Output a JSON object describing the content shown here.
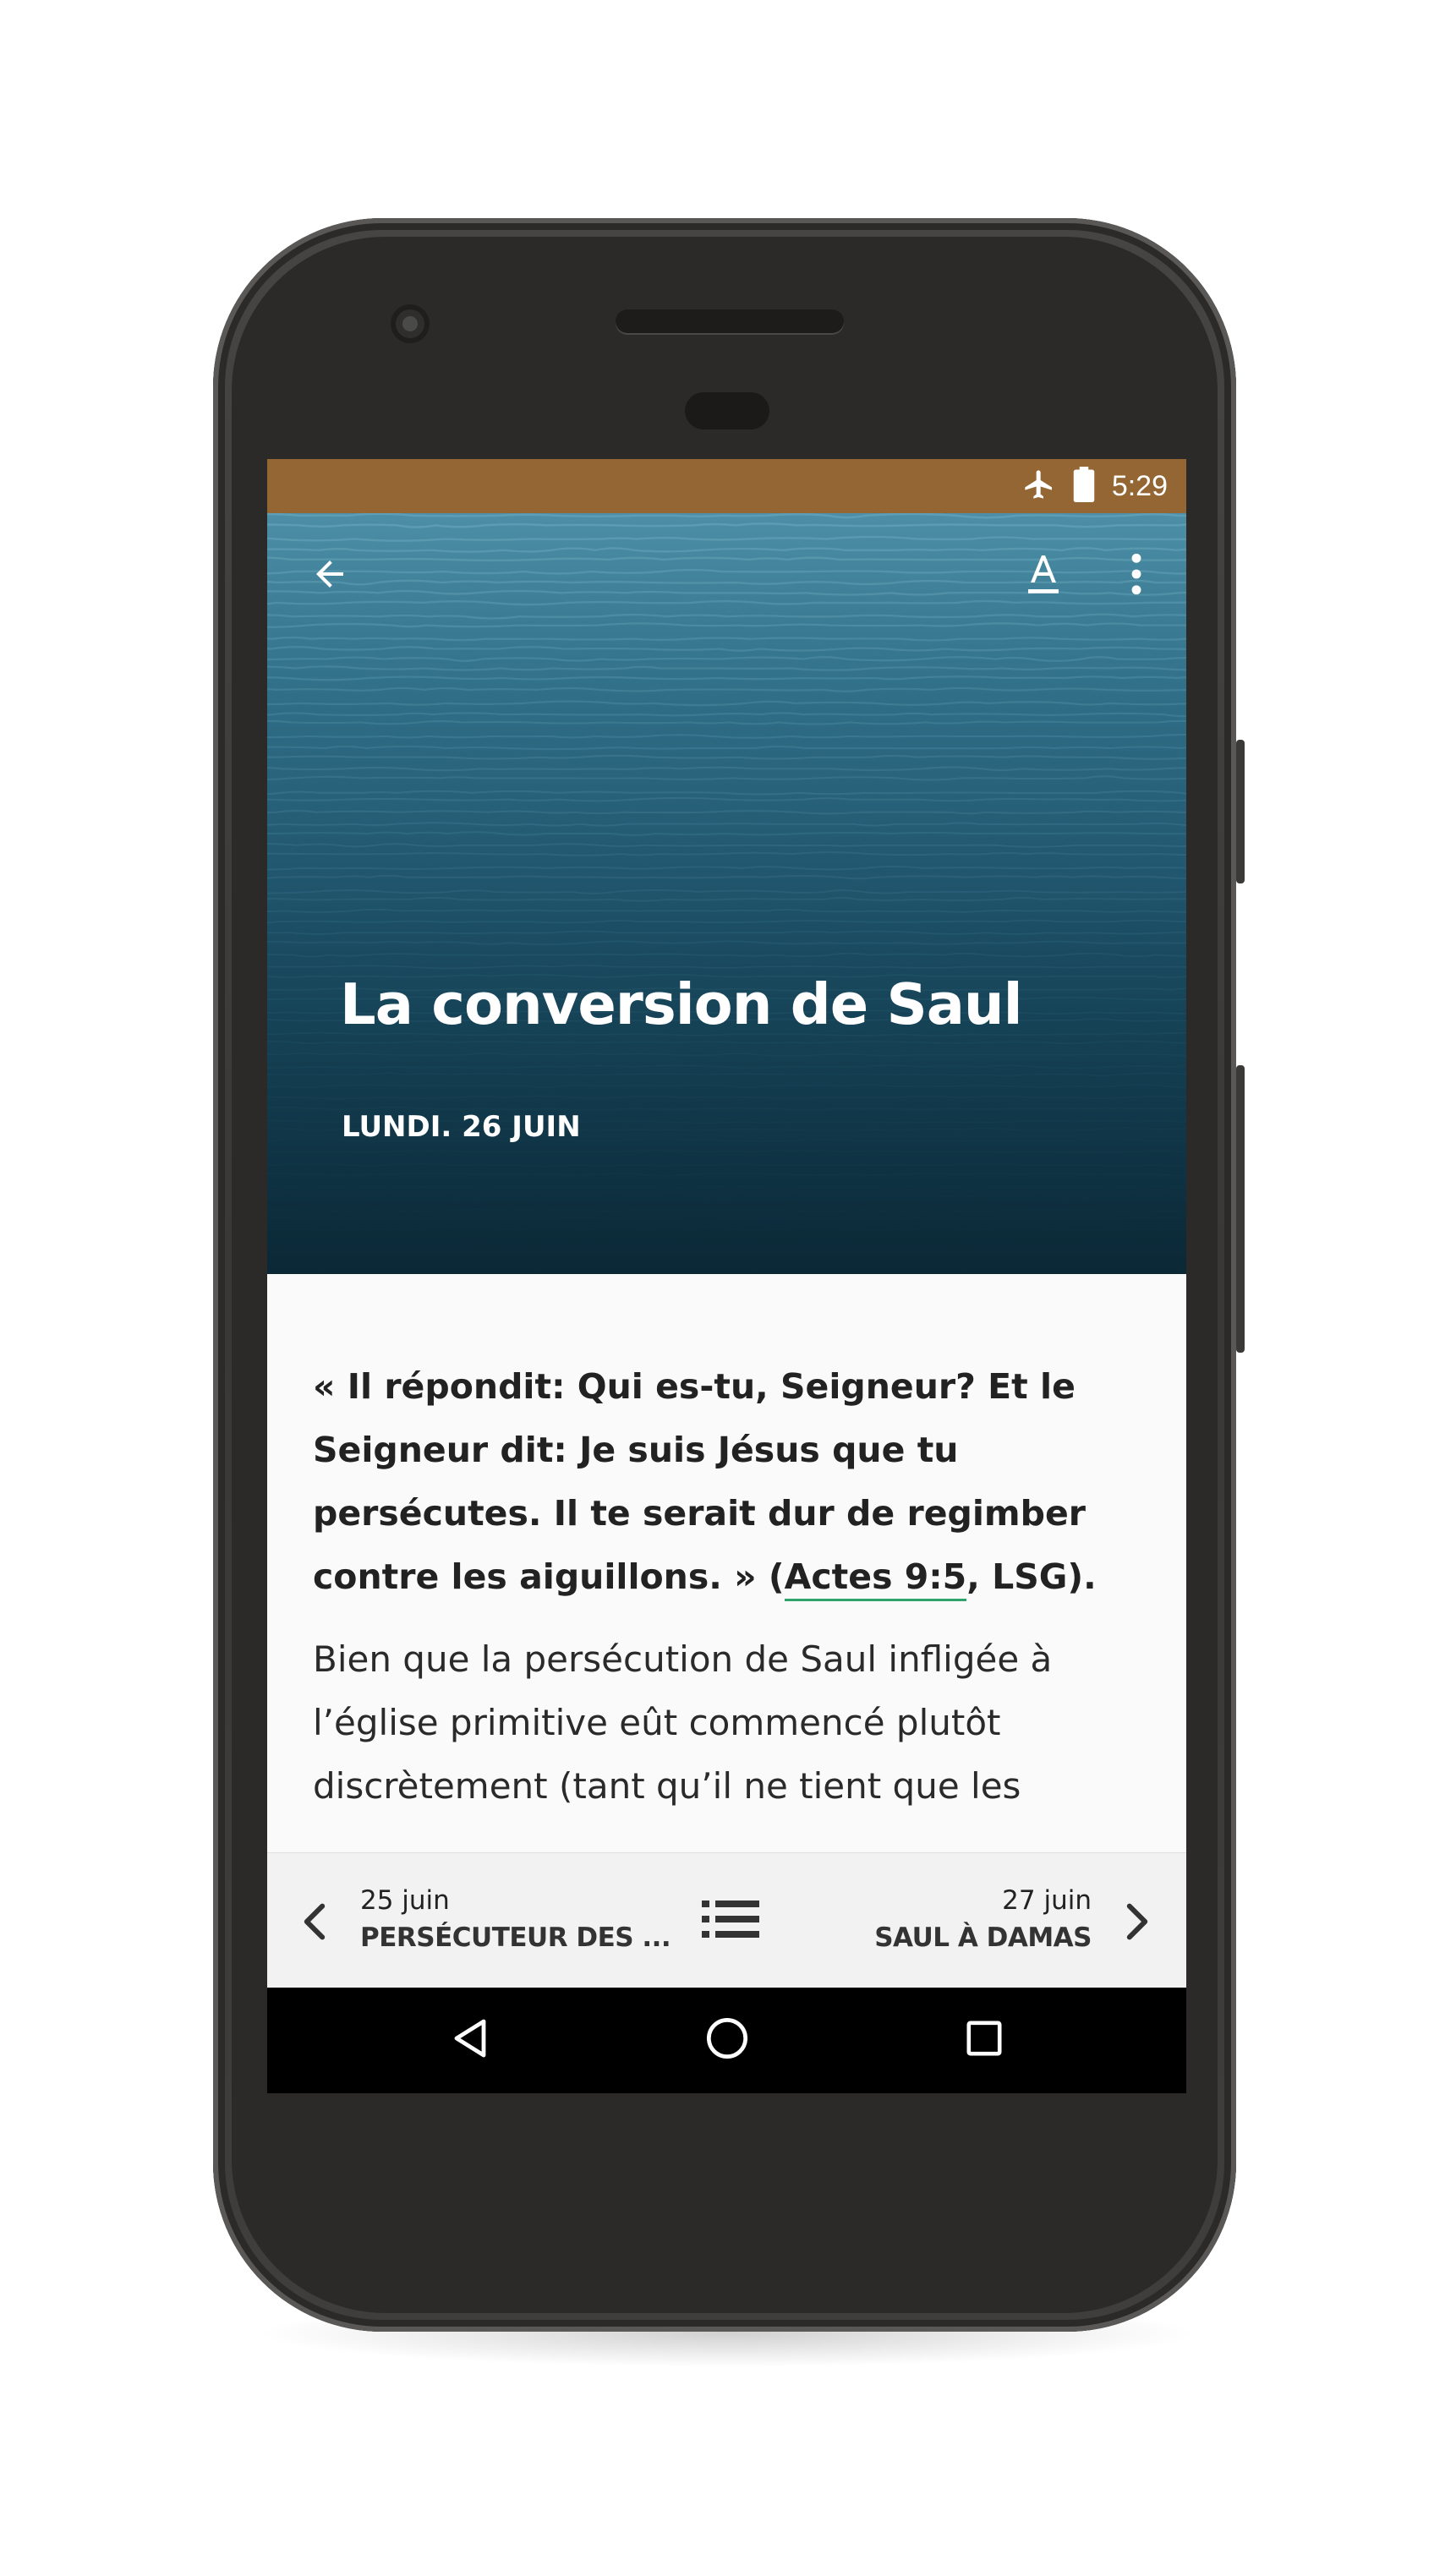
{
  "colors": {
    "status_bar": "#946633",
    "accent_underline": "#2fa36b",
    "nav_background": "#f2f2f2",
    "system_nav": "#000000",
    "phone_body": "#3a3836"
  },
  "status_bar": {
    "time": "5:29",
    "icons": [
      "airplane-mode-icon",
      "battery-icon"
    ]
  },
  "toolbar": {
    "icons": [
      "back-arrow-icon",
      "text-format-icon",
      "more-vert-icon"
    ]
  },
  "hero": {
    "title": "La conversion de Saul",
    "date": "LUNDI. 26 JUIN"
  },
  "content": {
    "quote_text": "« Il répondit: Qui es-tu, Seigneur? Et le Seigneur dit: Je suis Jésus que tu persécutes. Il te serait dur de regimber contre les aiguillons. » ",
    "quote_ref_open": "(",
    "quote_ref_link": "Actes 9:5",
    "quote_ref_close": ", LSG).",
    "paragraph": "Bien que la persécution de Saul infligée à l’église primitive eût commencé plutôt discrètement (tant qu’il ne tient que les"
  },
  "bottom_nav": {
    "prev_date": "25 juin",
    "prev_title": "PERSÉCUTEUR DES ...",
    "next_date": "27 juin",
    "next_title": "SAUL À DAMAS",
    "icons": [
      "chevron-left-icon",
      "list-icon",
      "chevron-right-icon"
    ]
  },
  "system_nav": {
    "icons": [
      "back-triangle-icon",
      "home-circle-icon",
      "recents-square-icon"
    ]
  }
}
